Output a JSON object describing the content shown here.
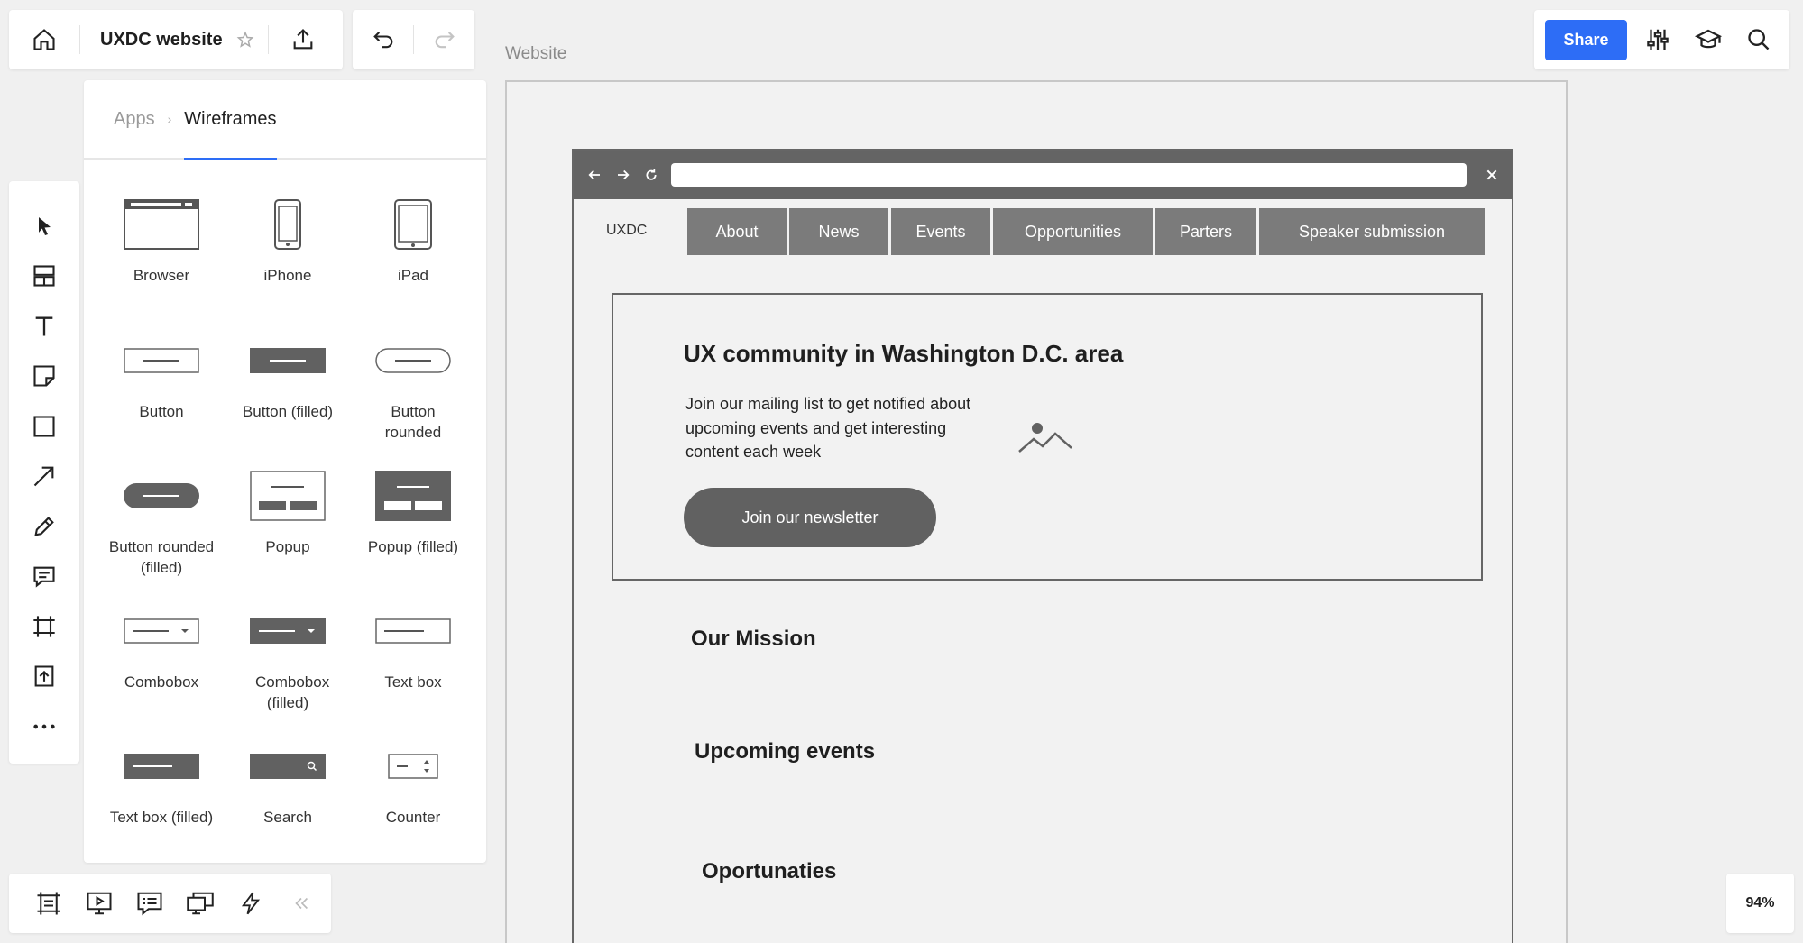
{
  "board": {
    "title": "UXDC website"
  },
  "topbar_right": {
    "share_label": "Share"
  },
  "frame": {
    "label": "Website"
  },
  "library": {
    "breadcrumb": {
      "parent": "Apps",
      "current": "Wireframes"
    },
    "items": [
      {
        "label": "Browser",
        "icon": "browser-icon"
      },
      {
        "label": "iPhone",
        "icon": "iphone-icon"
      },
      {
        "label": "iPad",
        "icon": "ipad-icon"
      },
      {
        "label": "Button",
        "icon": "button-icon"
      },
      {
        "label": "Button (filled)",
        "icon": "button-filled-icon"
      },
      {
        "label": "Button rounded",
        "icon": "button-rounded-icon"
      },
      {
        "label": "Button rounded (filled)",
        "icon": "button-rounded-filled-icon"
      },
      {
        "label": "Popup",
        "icon": "popup-icon"
      },
      {
        "label": "Popup (filled)",
        "icon": "popup-filled-icon"
      },
      {
        "label": "Combobox",
        "icon": "combobox-icon"
      },
      {
        "label": "Combobox (filled)",
        "icon": "combobox-filled-icon"
      },
      {
        "label": "Text box",
        "icon": "text-box-icon"
      },
      {
        "label": "Text box (filled)",
        "icon": "text-box-filled-icon"
      },
      {
        "label": "Search",
        "icon": "search-field-icon"
      },
      {
        "label": "Counter",
        "icon": "counter-icon"
      }
    ]
  },
  "left_toolbar": [
    "select-icon",
    "templates-icon",
    "text-icon",
    "sticky-note-icon",
    "shape-icon",
    "arrow-icon",
    "pen-icon",
    "comment-icon",
    "frame-icon",
    "upload-icon",
    "more-icon"
  ],
  "bottom_toolbar": [
    "frames-icon",
    "presentation-icon",
    "notes-icon",
    "screen-share-icon",
    "lightning-icon",
    "collapse-icon"
  ],
  "zoom": {
    "level": "94%"
  },
  "wireframe": {
    "logo": "UXDC",
    "nav": [
      "About",
      "News",
      "Events",
      "Opportunities",
      "Parters",
      "Speaker submission"
    ],
    "hero": {
      "title": "UX community in Washington D.C. area",
      "text": "Join our mailing list to get notified about upcoming events and get interesting content each week",
      "button": "Join our newsletter"
    },
    "sections": [
      "Our Mission",
      "Upcoming events",
      "Oportunaties"
    ]
  },
  "colors": {
    "accent": "#2d6df6",
    "wire_dark": "#646464",
    "wire_mid": "#7b7b7b"
  }
}
